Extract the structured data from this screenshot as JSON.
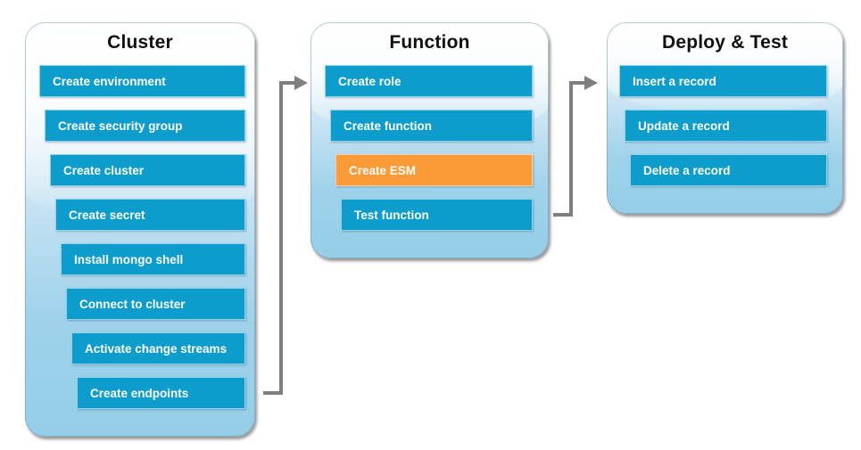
{
  "diagram": {
    "title": "Cluster / Function / Deploy and Test workflow",
    "colors": {
      "chip_blue": "#0d9dcd",
      "chip_orange": "#fd9a38",
      "card_top": "#fbfdfe",
      "card_bottom": "#95cee8",
      "connector_gray": "#7f7f7f",
      "title_text": "#12100e",
      "chip_text": "#ffffff"
    },
    "columns": [
      {
        "id": "cluster",
        "title": "Cluster",
        "steps": [
          {
            "label": "Create environment",
            "state": "normal"
          },
          {
            "label": "Create security group",
            "state": "normal"
          },
          {
            "label": "Create cluster",
            "state": "normal"
          },
          {
            "label": "Create secret",
            "state": "normal"
          },
          {
            "label": "Install mongo shell",
            "state": "normal"
          },
          {
            "label": "Connect to cluster",
            "state": "normal"
          },
          {
            "label": "Activate change streams",
            "state": "normal"
          },
          {
            "label": "Create endpoints",
            "state": "normal"
          }
        ]
      },
      {
        "id": "function",
        "title": "Function",
        "steps": [
          {
            "label": "Create role",
            "state": "normal"
          },
          {
            "label": "Create function",
            "state": "normal"
          },
          {
            "label": "Create ESM",
            "state": "highlighted"
          },
          {
            "label": "Test function",
            "state": "normal"
          }
        ]
      },
      {
        "id": "deploy-test",
        "title": "Deploy & Test",
        "steps": [
          {
            "label": "Insert a record",
            "state": "normal"
          },
          {
            "label": "Update a record",
            "state": "normal"
          },
          {
            "label": "Delete a record",
            "state": "normal"
          }
        ]
      }
    ],
    "connectors": [
      {
        "id": "cluster-to-function",
        "from": "cluster",
        "to": "function",
        "icon": "arrow-right-icon"
      },
      {
        "id": "function-to-deploy",
        "from": "function",
        "to": "deploy-test",
        "icon": "arrow-right-icon"
      }
    ]
  }
}
